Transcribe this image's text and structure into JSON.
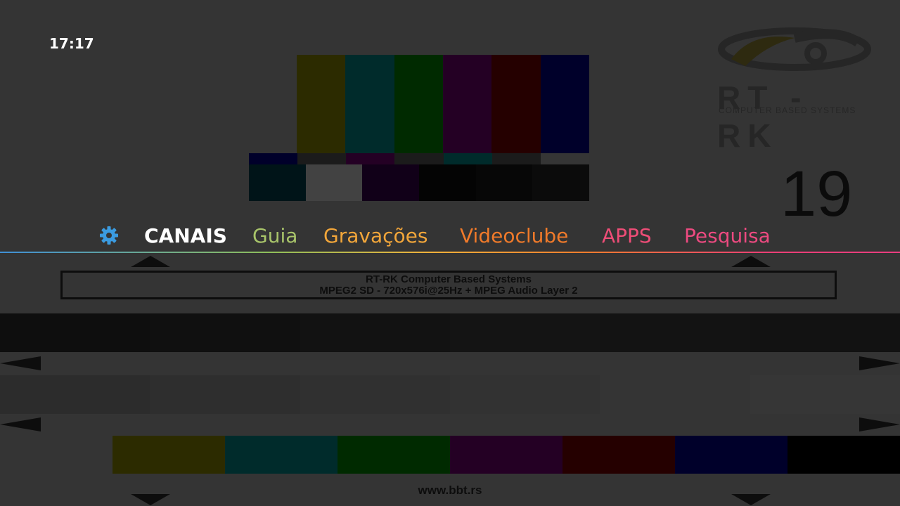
{
  "status_bar": {
    "clock": "17:17"
  },
  "menu": {
    "items": [
      {
        "label": "CANAIS",
        "color": "#ffffff"
      },
      {
        "label": "Guia",
        "color": "#a8c46a"
      },
      {
        "label": "Gravações",
        "color": "#f2a63a"
      },
      {
        "label": "Videoclube",
        "color": "#f07a2a"
      },
      {
        "label": "APPS",
        "color": "#ee4d77"
      },
      {
        "label": "Pesquisa",
        "color": "#ec4a80"
      }
    ],
    "settings_icon": "gear-icon",
    "accent": "#3b9be0"
  },
  "background": {
    "channel_number": "19",
    "logo": {
      "name": "RT - RK",
      "tagline": "COMPUTER BASED SYSTEMS"
    },
    "info_line1": "RT-RK Computer Based Systems",
    "info_line2": "MPEG2 SD - 720x576i@25Hz + MPEG Audio Layer 2",
    "website": "www.bbt.rs"
  }
}
